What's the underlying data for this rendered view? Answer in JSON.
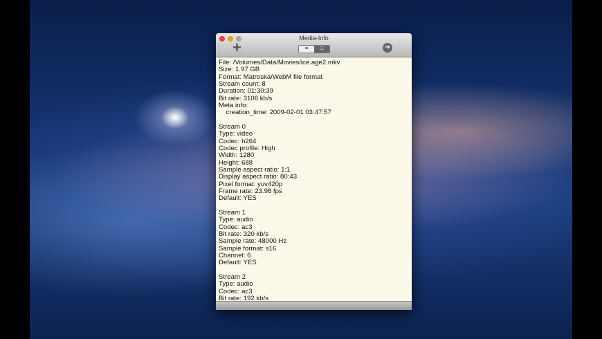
{
  "window": {
    "title": "Media-Info",
    "add_icon": "plus-icon",
    "go_icon": "arrow-right-circle-icon"
  },
  "lines": [
    "File: /Volumes/Data/Movies/ice.age2.mkv",
    "Size: 1.97 GB",
    "Format: Matroska/WebM file format",
    "Stream count: 8",
    "Duration: 01:30:39",
    "Bit rate: 3106 kb/s",
    "Meta info:",
    "    creation_time: 2009-02-01 03:47:57",
    "",
    "Stream 0",
    "Type: video",
    "Codec: h264",
    "Codec profile: High",
    "Width: 1280",
    "Height: 688",
    "Sample aspect ratio: 1:1",
    "Display aspect ratio: 80:43",
    "Pixel format: yuv420p",
    "Frame rate: 23.98 fps",
    "Default: YES",
    "",
    "Stream 1",
    "Type: audio",
    "Codec: ac3",
    "Bit rate: 320 kb/s",
    "Sample rate: 48000 Hz",
    "Sample format: s16",
    "Channel: 6",
    "Default: YES",
    "",
    "Stream 2",
    "Type: audio",
    "Codec: ac3",
    "Bit rate: 192 kb/s"
  ]
}
